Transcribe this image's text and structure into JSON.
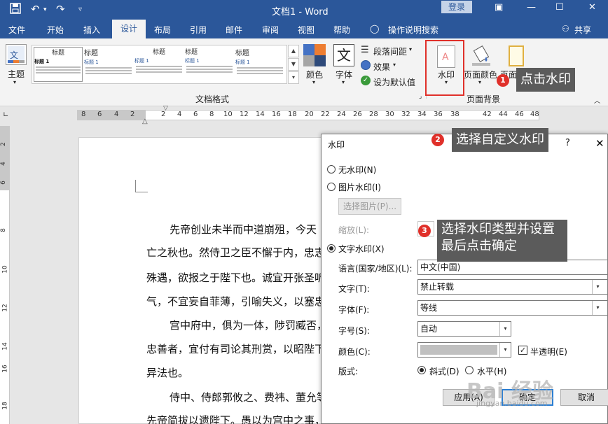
{
  "titlebar": {
    "doc_title": "文档1  -  Word",
    "login": "登录"
  },
  "tabs": [
    "文件",
    "开始",
    "插入",
    "设计",
    "布局",
    "引用",
    "邮件",
    "审阅",
    "视图",
    "帮助"
  ],
  "tell_me": "操作说明搜索",
  "share": "共享",
  "ribbon": {
    "theme_label": "主题",
    "style_thumbs": [
      {
        "heading": "标题",
        "subheading": "标题 1"
      },
      {
        "heading": "标题",
        "subheading": "标题 1"
      },
      {
        "heading": "标题",
        "subheading": "标题 1"
      },
      {
        "heading": "标题",
        "subheading": "标题 1"
      },
      {
        "heading": "标题",
        "subheading": "标题 1"
      }
    ],
    "colors_label": "颜色",
    "fonts_label": "字体",
    "paragraph_spacing": "段落间距",
    "effects": "效果",
    "set_default": "设为默认值",
    "doc_format_group": "文档格式",
    "watermark_label": "水印",
    "page_color_label": "页面颜色",
    "page_border_label": "页面边框",
    "page_bg_group": "页面背景"
  },
  "ruler_numbers": [
    "8",
    "6",
    "4",
    "2",
    "2",
    "4",
    "6",
    "8",
    "10",
    "12",
    "14",
    "16",
    "18",
    "20",
    "22",
    "24",
    "26",
    "28",
    "30",
    "32",
    "34",
    "36",
    "38",
    "42",
    "44",
    "46",
    "48"
  ],
  "vruler_numbers": [
    "2",
    "4",
    "6",
    "8",
    "10",
    "12",
    "14",
    "16",
    "18"
  ],
  "document": {
    "lines": [
      "先帝创业未半而中道崩殂，今天",
      "亡之秋也。然侍卫之臣不懈于内，忠志",
      "殊遇，欲报之于陛下也。诚宜开张圣听",
      "气，不宜妄自菲薄，引喻失义，以塞忠",
      "宫中府中，俱为一体，陟罚臧否，",
      "忠善者，宜付有司论其刑赏，以昭陛下",
      "异法也。",
      "侍中、侍郎郭攸之、费祎、董允等",
      "先帝简拔以遗陛下。愚以为宫中之事，事无大小，悉以咨之，然后施"
    ]
  },
  "dialog": {
    "title": "水印",
    "help": "?",
    "no_watermark": "无水印(N)",
    "picture_watermark": "图片水印(I)",
    "select_picture": "选择图片(P)...",
    "scale_label": "缩放(L):",
    "text_watermark": "文字水印(X)",
    "language_label": "语言(国家/地区)(L):",
    "language_value": "中文(中国)",
    "text_label": "文字(T):",
    "text_value": "禁止转载",
    "font_label": "字体(F):",
    "font_value": "等线",
    "size_label": "字号(S):",
    "size_value": "自动",
    "color_label": "颜色(C):",
    "semi_transparent": "半透明(E)",
    "layout_label": "版式:",
    "diagonal": "斜式(D)",
    "horizontal": "水平(H)",
    "apply": "应用(A)",
    "ok": "确定",
    "cancel": "取消"
  },
  "callouts": {
    "step1": "点击水印",
    "step2": "选择自定义水印",
    "step3_line1": "选择水印类型并设置",
    "step3_line2": "最后点击确定",
    "badge1": "1",
    "badge2": "2",
    "badge3": "3"
  },
  "watermark_overlay": {
    "brand": "Bai 经验",
    "url": "jingyan.baidu.com"
  },
  "colors": {
    "title_blue": "#2b579a",
    "callout_bg": "#5b5b5b",
    "badge_red": "#e0302a"
  }
}
